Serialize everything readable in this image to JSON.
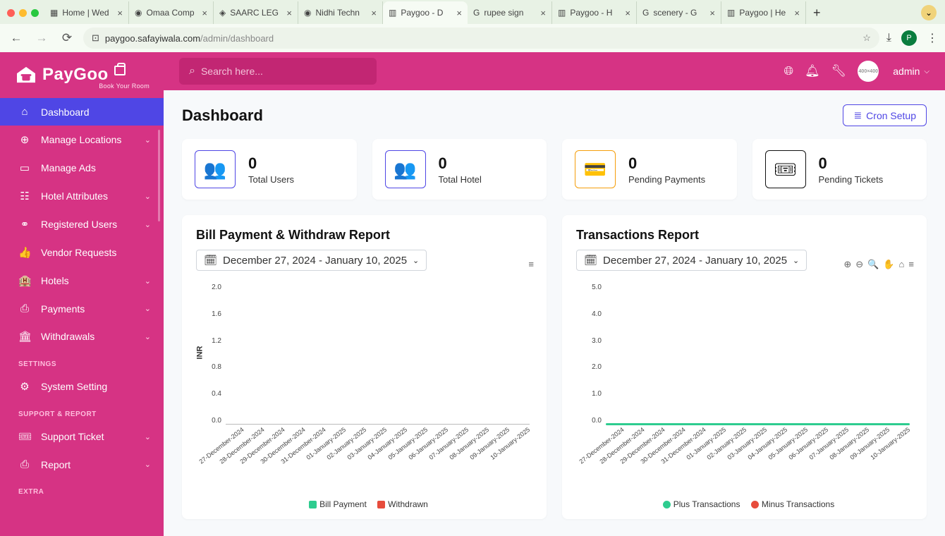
{
  "browser": {
    "tabs": [
      {
        "label": "Home | Wed"
      },
      {
        "label": "Omaa Comp"
      },
      {
        "label": "SAARC LEG"
      },
      {
        "label": "Nidhi Techn"
      },
      {
        "label": "Paygoo - D",
        "active": true
      },
      {
        "label": "rupee sign"
      },
      {
        "label": "Paygoo - H"
      },
      {
        "label": "scenery - G"
      },
      {
        "label": "Paygoo | He"
      }
    ],
    "url_host": "paygoo.safayiwala.com",
    "url_path": "/admin/dashboard"
  },
  "app": {
    "logo": {
      "text": "PayGoo",
      "sub": "Book Your Room"
    },
    "search": {
      "placeholder": "Search here..."
    },
    "user": {
      "name": "admin",
      "avatar": "400×400"
    },
    "sidebar": {
      "items": [
        {
          "label": "Dashboard",
          "active": true,
          "chevron": false
        },
        {
          "label": "Manage Locations",
          "chevron": true
        },
        {
          "label": "Manage Ads",
          "chevron": false
        },
        {
          "label": "Hotel Attributes",
          "chevron": true
        },
        {
          "label": "Registered Users",
          "chevron": true
        },
        {
          "label": "Vendor Requests",
          "chevron": false
        },
        {
          "label": "Hotels",
          "chevron": true
        },
        {
          "label": "Payments",
          "chevron": true
        },
        {
          "label": "Withdrawals",
          "chevron": true
        }
      ],
      "section_settings": "SETTINGS",
      "settings_items": [
        {
          "label": "System Setting",
          "chevron": false
        }
      ],
      "section_support": "SUPPORT & REPORT",
      "support_items": [
        {
          "label": "Support Ticket",
          "chevron": true
        },
        {
          "label": "Report",
          "chevron": true
        }
      ],
      "section_extra": "EXTRA"
    },
    "page": {
      "title": "Dashboard",
      "cron_button": "Cron Setup"
    },
    "stats": [
      {
        "value": "0",
        "label": "Total Users",
        "color": "#4f46e5"
      },
      {
        "value": "0",
        "label": "Total Hotel",
        "color": "#4f46e5"
      },
      {
        "value": "0",
        "label": "Pending Payments",
        "color": "#f59e0b"
      },
      {
        "value": "0",
        "label": "Pending Tickets",
        "color": "#111"
      }
    ],
    "chart1": {
      "title": "Bill Payment & Withdraw Report",
      "date_range": "December 27, 2024 - January 10, 2025",
      "ylabel": "INR",
      "legend": [
        "Bill Payment",
        "Withdrawn"
      ],
      "legend_colors": [
        "#2ecc8f",
        "#e74c3c"
      ]
    },
    "chart2": {
      "title": "Transactions Report",
      "date_range": "December 27, 2024 - January 10, 2025",
      "legend": [
        "Plus Transactions",
        "Minus Transactions"
      ],
      "legend_colors": [
        "#2ecc8f",
        "#e74c3c"
      ]
    }
  },
  "chart_data": [
    {
      "type": "bar",
      "title": "Bill Payment & Withdraw Report",
      "xlabel": "",
      "ylabel": "INR",
      "ylim": [
        0,
        2.0
      ],
      "yticks": [
        2.0,
        1.6,
        1.2,
        0.8,
        0.4,
        0.0
      ],
      "categories": [
        "27-December-2024",
        "28-December-2024",
        "29-December-2024",
        "30-December-2024",
        "31-December-2024",
        "01-January-2025",
        "02-January-2025",
        "03-January-2025",
        "04-January-2025",
        "05-January-2025",
        "06-January-2025",
        "07-January-2025",
        "08-January-2025",
        "09-January-2025",
        "10-January-2025"
      ],
      "series": [
        {
          "name": "Bill Payment",
          "color": "#2ecc8f",
          "values": [
            0,
            0,
            0,
            0,
            0,
            0,
            0,
            0,
            0,
            0,
            0,
            0,
            0,
            0,
            0
          ]
        },
        {
          "name": "Withdrawn",
          "color": "#e74c3c",
          "values": [
            0,
            0,
            0,
            0,
            0,
            0,
            0,
            0,
            0,
            0,
            0,
            0,
            0,
            0,
            0
          ]
        }
      ]
    },
    {
      "type": "area",
      "title": "Transactions Report",
      "xlabel": "",
      "ylabel": "",
      "ylim": [
        0,
        5.0
      ],
      "yticks": [
        5.0,
        4.0,
        3.0,
        2.0,
        1.0,
        0.0
      ],
      "categories": [
        "27-December-2024",
        "28-December-2024",
        "29-December-2024",
        "30-December-2024",
        "31-December-2024",
        "01-January-2025",
        "02-January-2025",
        "03-January-2025",
        "04-January-2025",
        "05-January-2025",
        "06-January-2025",
        "07-January-2025",
        "08-January-2025",
        "09-January-2025",
        "10-January-2025"
      ],
      "series": [
        {
          "name": "Plus Transactions",
          "color": "#2ecc8f",
          "values": [
            0,
            0,
            0,
            0,
            0,
            0,
            0,
            0,
            0,
            0,
            0,
            0,
            0,
            0,
            0
          ]
        },
        {
          "name": "Minus Transactions",
          "color": "#e74c3c",
          "values": [
            0,
            0,
            0,
            0,
            0,
            0,
            0,
            0,
            0,
            0,
            0,
            0,
            0,
            0,
            0
          ]
        }
      ]
    }
  ]
}
